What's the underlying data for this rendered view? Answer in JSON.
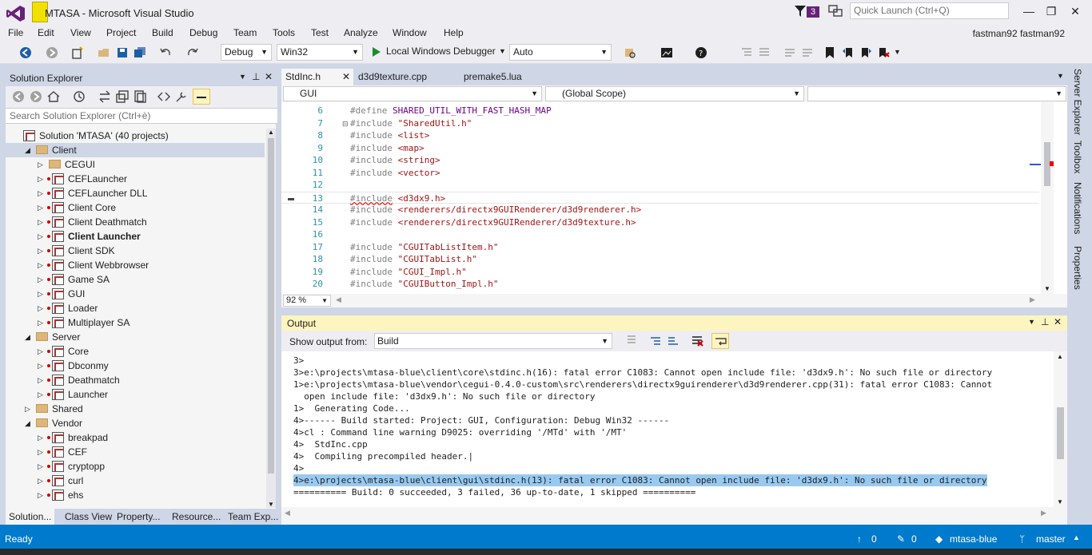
{
  "window": {
    "title": "MTASA - Microsoft Visual Studio",
    "notification_count": "3",
    "quick_launch_placeholder": "Quick Launch (Ctrl+Q)",
    "minimize": "—",
    "restore": "❐",
    "close": "✕"
  },
  "menu": {
    "items": [
      "File",
      "Edit",
      "View",
      "Project",
      "Build",
      "Debug",
      "Team",
      "Tools",
      "Test",
      "Analyze",
      "Window",
      "Help"
    ],
    "user": "fastman92 fastman92"
  },
  "toolbar": {
    "configuration": "Debug",
    "platform": "Win32",
    "debugger": "Local Windows Debugger",
    "debugger_mode": "Auto"
  },
  "solution_explorer": {
    "title": "Solution Explorer",
    "search_placeholder": "Search Solution Explorer (Ctrl+è)",
    "tree": [
      {
        "label": "Solution 'MTASA' (40 projects)",
        "kind": "solution",
        "level": 0,
        "arrow": ""
      },
      {
        "label": "Client",
        "kind": "folder",
        "level": 1,
        "arrow": "◢",
        "selected": true
      },
      {
        "label": "CEGUI",
        "kind": "folder",
        "level": 2,
        "arrow": "▷"
      },
      {
        "label": "CEFLauncher",
        "kind": "project",
        "level": 2,
        "arrow": "▷"
      },
      {
        "label": "CEFLauncher DLL",
        "kind": "project",
        "level": 2,
        "arrow": "▷"
      },
      {
        "label": "Client Core",
        "kind": "project",
        "level": 2,
        "arrow": "▷"
      },
      {
        "label": "Client Deathmatch",
        "kind": "project",
        "level": 2,
        "arrow": "▷"
      },
      {
        "label": "Client Launcher",
        "kind": "project",
        "level": 2,
        "arrow": "▷",
        "bold": true
      },
      {
        "label": "Client SDK",
        "kind": "project",
        "level": 2,
        "arrow": "▷"
      },
      {
        "label": "Client Webbrowser",
        "kind": "project",
        "level": 2,
        "arrow": "▷"
      },
      {
        "label": "Game SA",
        "kind": "project",
        "level": 2,
        "arrow": "▷"
      },
      {
        "label": "GUI",
        "kind": "project",
        "level": 2,
        "arrow": "▷"
      },
      {
        "label": "Loader",
        "kind": "project",
        "level": 2,
        "arrow": "▷"
      },
      {
        "label": "Multiplayer SA",
        "kind": "project",
        "level": 2,
        "arrow": "▷"
      },
      {
        "label": "Server",
        "kind": "folder",
        "level": 1,
        "arrow": "◢"
      },
      {
        "label": "Core",
        "kind": "project",
        "level": 2,
        "arrow": "▷"
      },
      {
        "label": "Dbconmy",
        "kind": "project",
        "level": 2,
        "arrow": "▷"
      },
      {
        "label": "Deathmatch",
        "kind": "project",
        "level": 2,
        "arrow": "▷"
      },
      {
        "label": "Launcher",
        "kind": "project",
        "level": 2,
        "arrow": "▷"
      },
      {
        "label": "Shared",
        "kind": "folder",
        "level": 1,
        "arrow": "▷"
      },
      {
        "label": "Vendor",
        "kind": "folder",
        "level": 1,
        "arrow": "◢"
      },
      {
        "label": "breakpad",
        "kind": "project",
        "level": 2,
        "arrow": "▷"
      },
      {
        "label": "CEF",
        "kind": "project",
        "level": 2,
        "arrow": "▷"
      },
      {
        "label": "cryptopp",
        "kind": "project",
        "level": 2,
        "arrow": "▷"
      },
      {
        "label": "curl",
        "kind": "project",
        "level": 2,
        "arrow": "▷"
      },
      {
        "label": "ehs",
        "kind": "project",
        "level": 2,
        "arrow": "▷"
      }
    ],
    "tabs": [
      "Solution...",
      "Class View",
      "Property...",
      "Resource...",
      "Team Exp..."
    ]
  },
  "editor": {
    "tabs": [
      "StdInc.h",
      "d3d9texture.cpp",
      "premake5.lua"
    ],
    "tab_close": "✕",
    "nav_project": "GUI",
    "nav_scope": "(Global Scope)",
    "nav_member": "",
    "zoom": "92 %",
    "lines": [
      {
        "n": "6",
        "pre": "#define",
        "post": " SHARED_UTIL_WITH_FAST_HASH_MAP",
        "post_kind": "mac"
      },
      {
        "n": "7",
        "pre": "#include",
        "post": " \"SharedUtil.h\"",
        "post_kind": "str"
      },
      {
        "n": "8",
        "pre": "#include",
        "post": " <list>",
        "post_kind": "str"
      },
      {
        "n": "9",
        "pre": "#include",
        "post": " <map>",
        "post_kind": "str"
      },
      {
        "n": "10",
        "pre": "#include",
        "post": " <string>",
        "post_kind": "str"
      },
      {
        "n": "11",
        "pre": "#include",
        "post": " <vector>",
        "post_kind": "str"
      },
      {
        "n": "12",
        "pre": "",
        "post": "",
        "post_kind": "str"
      },
      {
        "n": "13",
        "pre": "#include",
        "post": " <d3dx9.h>",
        "post_kind": "str",
        "current": true
      },
      {
        "n": "14",
        "pre": "#include",
        "post": " <renderers/directx9GUIRenderer/d3d9renderer.h>",
        "post_kind": "str"
      },
      {
        "n": "15",
        "pre": "#include",
        "post": " <renderers/directx9GUIRenderer/d3d9texture.h>",
        "post_kind": "str"
      },
      {
        "n": "16",
        "pre": "",
        "post": "",
        "post_kind": "str"
      },
      {
        "n": "17",
        "pre": "#include",
        "post": " \"CGUITabListItem.h\"",
        "post_kind": "str"
      },
      {
        "n": "18",
        "pre": "#include",
        "post": " \"CGUITabList.h\"",
        "post_kind": "str"
      },
      {
        "n": "19",
        "pre": "#include",
        "post": " \"CGUI_Impl.h\"",
        "post_kind": "str"
      },
      {
        "n": "20",
        "pre": "#include",
        "post": " \"CGUIButton_Impl.h\"",
        "post_kind": "str"
      }
    ]
  },
  "output": {
    "title": "Output",
    "show_from_label": "Show output from:",
    "source": "Build",
    "lines": [
      {
        "text": "3>"
      },
      {
        "text": "3>e:\\projects\\mtasa-blue\\client\\core\\stdinc.h(16): fatal error C1083: Cannot open include file: 'd3dx9.h': No such file or directory"
      },
      {
        "text": "1>e:\\projects\\mtasa-blue\\vendor\\cegui-0.4.0-custom\\src\\renderers\\directx9guirenderer\\d3d9renderer.cpp(31): fatal error C1083: Cannot"
      },
      {
        "text": "  open include file: 'd3dx9.h': No such file or directory"
      },
      {
        "text": "1>  Generating Code..."
      },
      {
        "text": "4>------ Build started: Project: GUI, Configuration: Debug Win32 ------"
      },
      {
        "text": "4>cl : Command line warning D9025: overriding '/MTd' with '/MT'"
      },
      {
        "text": "4>  StdInc.cpp"
      },
      {
        "text": "4>  Compiling precompiled header.|"
      },
      {
        "text": "4>"
      },
      {
        "text": "4>e:\\projects\\mtasa-blue\\client\\gui\\stdinc.h(13): fatal error C1083: Cannot open include file: 'd3dx9.h': No such file or directory",
        "highlight": true
      },
      {
        "text": "========== Build: 0 succeeded, 3 failed, 36 up-to-date, 1 skipped =========="
      }
    ]
  },
  "right_rail": [
    "Server Explorer",
    "Toolbox",
    "Notifications",
    "Properties"
  ],
  "status": {
    "ready": "Ready",
    "up_arrow": "↑",
    "incoming": "0",
    "pencil": "✎",
    "changes": "0",
    "repo_icon": "◆",
    "repo": "mtasa-blue",
    "branch_icon": "ᛘ",
    "branch": "master",
    "dropdown_icon": "▲"
  },
  "colors": {
    "accent": "#007acc",
    "output_header": "#fdf4bf",
    "selection": "#99c9ef"
  }
}
